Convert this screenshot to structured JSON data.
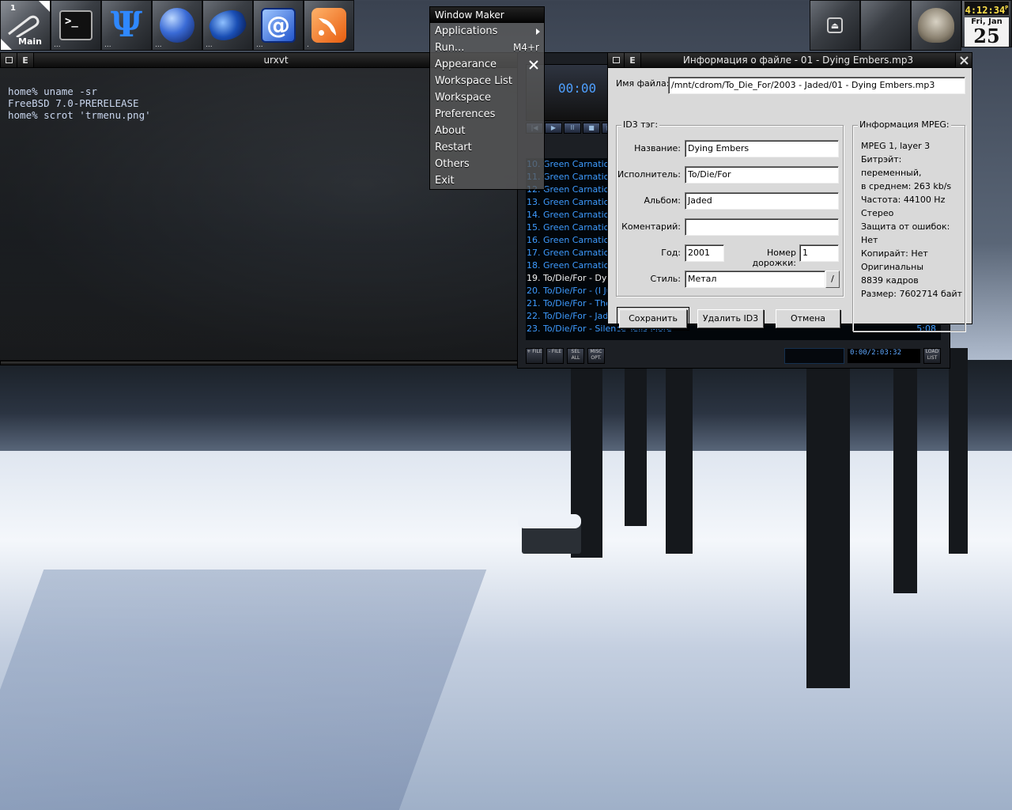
{
  "dock": {
    "clip": {
      "workspace_number": "1",
      "workspace_name": "Main"
    },
    "icons": [
      "clip-icon",
      "terminal-icon",
      "psi-icon",
      "globe-icon",
      "dolphin-icon",
      "mail-at-icon",
      "rss-feed-icon"
    ],
    "right": {
      "clock_time": "4:12:34",
      "clock_ampm": "P",
      "clock_day": "Fri, Jan",
      "clock_date": "25"
    }
  },
  "urxvt": {
    "title": "urxvt",
    "lines": [
      "home% uname -sr",
      "FreeBSD 7.0-PRERELEASE",
      "home% scrot 'trmenu.png'"
    ]
  },
  "wm_menu": {
    "title": "Window Maker",
    "items": [
      {
        "label": "Applications",
        "submenu": true
      },
      {
        "label": "Run...",
        "shortcut": "M4+r"
      },
      {
        "label": "Appearance",
        "submenu": true
      },
      {
        "label": "Workspace List",
        "submenu": false
      },
      {
        "label": "Workspace",
        "submenu": false
      },
      {
        "label": "Preferences",
        "submenu": false
      },
      {
        "label": "About",
        "submenu": false
      },
      {
        "label": "Restart",
        "submenu": false
      },
      {
        "label": "Others",
        "submenu": false
      },
      {
        "label": "Exit",
        "submenu": false
      }
    ]
  },
  "player": {
    "digits": "00:00",
    "playlist": [
      {
        "text": "10. Green Carnation",
        "current": false
      },
      {
        "text": "11. Green Carnation",
        "current": false
      },
      {
        "text": "12. Green Carnation",
        "current": false
      },
      {
        "text": "13. Green Carnation",
        "current": false
      },
      {
        "text": "14. Green Carnation",
        "current": false
      },
      {
        "text": "15. Green Carnation",
        "current": false
      },
      {
        "text": "16. Green Carnation",
        "current": false
      },
      {
        "text": "17. Green Carnation",
        "current": false
      },
      {
        "text": "18. Green Carnation",
        "current": false
      },
      {
        "text": "19. To/Die/For - Dyin",
        "current": true
      },
      {
        "text": "20. To/Die/For - (I Ju",
        "current": false
      },
      {
        "text": "21. To/Die/For - The",
        "current": false
      },
      {
        "text": "22. To/Die/For - Jade",
        "current": false
      },
      {
        "text": "23. To/Die/For - Silence Tells More",
        "current": false,
        "duration": "5:08"
      }
    ],
    "bottom_buttons": [
      "+ FILE",
      "- FILE",
      "SEL ALL",
      "MISC OPT."
    ],
    "time": "0:00/2:03:32",
    "load_list": "LOAD LIST"
  },
  "file_info": {
    "title": "Информация о файле - 01 - Dying Embers.mp3",
    "filename_label": "Имя файла:",
    "filename": "/mnt/cdrom/To_Die_For/2003 - Jaded/01 - Dying Embers.mp3",
    "id3": {
      "group_label": "ID3 тэг:",
      "title_label": "Название:",
      "title": "Dying Embers",
      "artist_label": "Исполнитель:",
      "artist": "To/Die/For",
      "album_label": "Альбом:",
      "album": "Jaded",
      "comment_label": "Коментарий:",
      "comment": "",
      "year_label": "Год:",
      "year": "2001",
      "track_label": "Номер дорожки:",
      "track": "1",
      "genre_label": "Стиль:",
      "genre": "Метал"
    },
    "mpeg": {
      "group_label": "Информация MPEG:",
      "lines": [
        "MPEG 1, layer 3",
        "Битрэйт: переменный,",
        "в среднем: 263 kb/s",
        "Частота: 44100 Hz",
        "Стерео",
        "Защита от ошибок: Нет",
        "Копирайт: Нет",
        "Оригинальны",
        "8839 кадров",
        "Размер: 7602714 байт"
      ]
    },
    "buttons": {
      "save": "Сохранить",
      "remove_id3": "Удалить ID3",
      "cancel": "Отмена"
    }
  }
}
